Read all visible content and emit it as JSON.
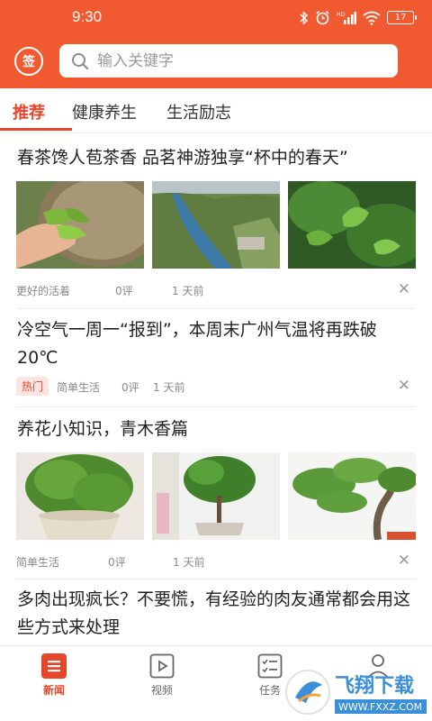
{
  "status_bar": {
    "time": "9:30",
    "battery": "17",
    "icons": [
      "bluetooth-icon",
      "alarm-icon",
      "signal-icon",
      "wifi-icon",
      "battery-icon"
    ]
  },
  "header": {
    "signin_label": "签",
    "search_placeholder": "输入关键字"
  },
  "tabs": [
    {
      "label": "推荐",
      "active": true
    },
    {
      "label": "健康养生",
      "active": false
    },
    {
      "label": "生活励志",
      "active": false
    }
  ],
  "articles": [
    {
      "title": "春茶馋人苞茶香 品茗神游独享“杯中的春天”",
      "source": "更好的活着",
      "comments": "0评",
      "time": "1 天前",
      "images": [
        "tea-leaves-in-hand",
        "river-valley-landscape",
        "tea-bush-closeup"
      ]
    },
    {
      "title": "冷空气一周一“报到”，本周末广州气温将再跌破20℃",
      "badge": "热门",
      "source": "简单生活",
      "comments": "0评",
      "time": "1 天前"
    },
    {
      "title": "养花小知识，青木香篇",
      "source": "简单生活",
      "comments": "0评",
      "time": "1 天前",
      "images": [
        "potted-green-plant",
        "bonsai-tree-pot",
        "bonsai-branches"
      ]
    },
    {
      "title": "多肉出现疯长？不要慌，有经验的肉友通常都会用这些方式来处理"
    }
  ],
  "bottom_nav": [
    {
      "label": "新闻",
      "icon": "news-icon",
      "active": true
    },
    {
      "label": "视频",
      "icon": "video-icon",
      "active": false
    },
    {
      "label": "任务",
      "icon": "task-icon",
      "active": false
    },
    {
      "label": "",
      "icon": "profile-icon",
      "active": false
    }
  ],
  "watermark": {
    "brand": "飞翔下载",
    "url": "WWW.FXXZ.COM"
  },
  "colors": {
    "brand": "#f15a30",
    "accent": "#e8462a",
    "hot_badge_bg": "#fbe4e1"
  },
  "close_symbol": "✕"
}
